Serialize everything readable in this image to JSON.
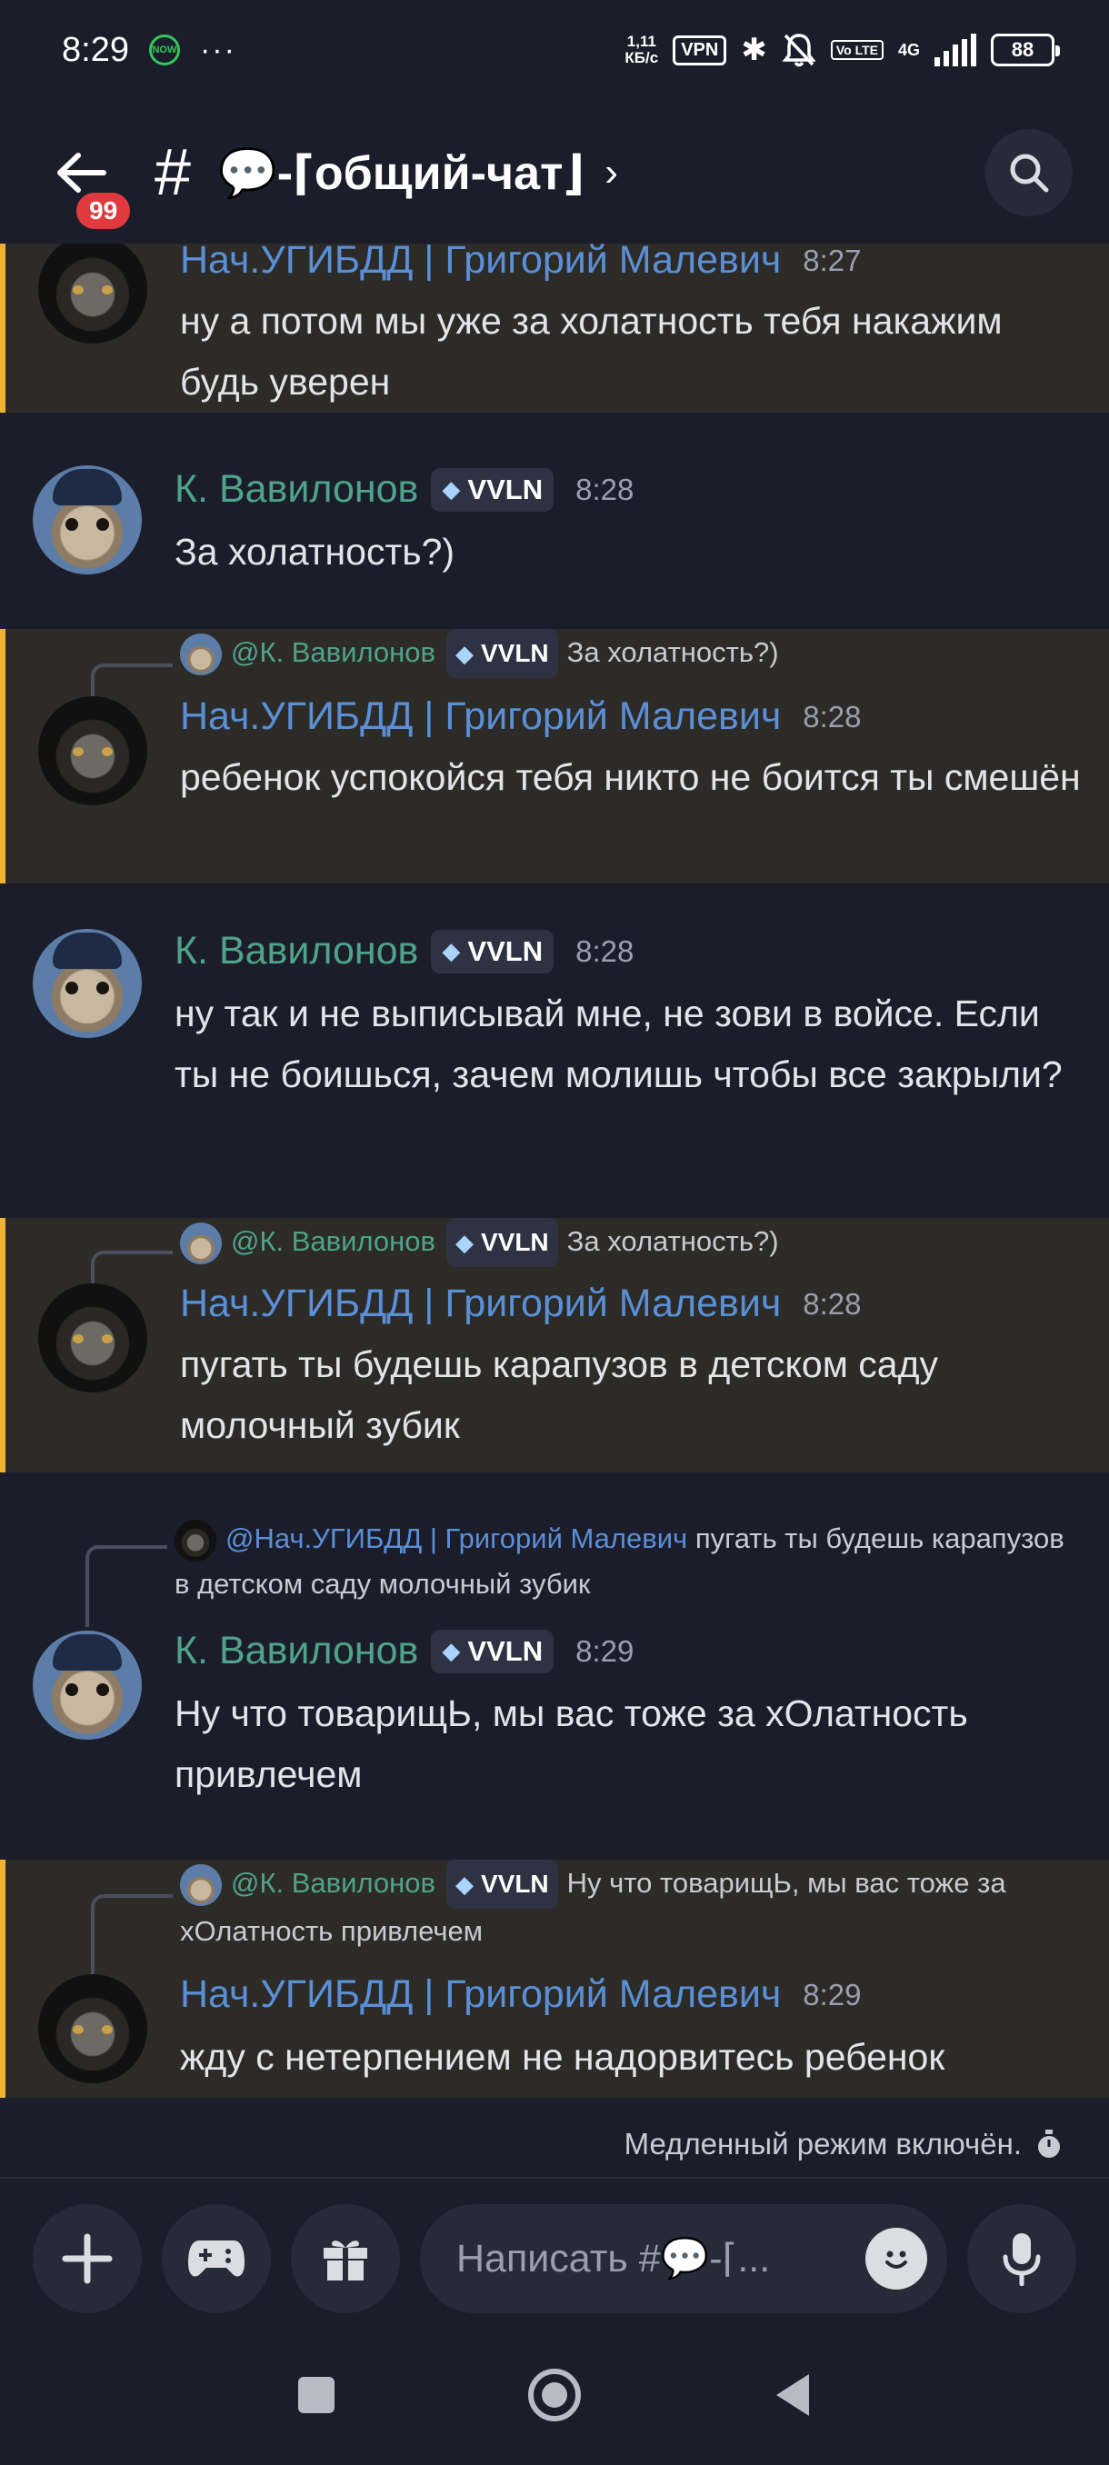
{
  "status_bar": {
    "time": "8:29",
    "now_badge": "NOW",
    "more": "···",
    "net_speed_value": "1,11",
    "net_speed_unit": "КБ/с",
    "vpn": "VPN",
    "volte": "Vo LTE",
    "network": "4G",
    "battery": "88"
  },
  "header": {
    "unread_badge": "99",
    "channel_hash": "#",
    "channel_name": "💬-⌈общий-чат⌋",
    "chevron": "›"
  },
  "messages": [
    {
      "author": "Нач.УГИБДД | Григорий Малевич",
      "time": "8:27",
      "text": "ну а потом мы уже за холатность тебя накажим будь уверен"
    },
    {
      "author": "К. Вавилонов",
      "tag": "VVLN",
      "time": "8:28",
      "text": "За холатность?)"
    },
    {
      "reply_to": "@К. Вавилонов",
      "reply_tag": "VVLN",
      "reply_text": "За холатность?)",
      "author": "Нач.УГИБДД | Григорий Малевич",
      "time": "8:28",
      "text": "ребенок успокойся тебя никто не боится ты смешён"
    },
    {
      "author": "К. Вавилонов",
      "tag": "VVLN",
      "time": "8:28",
      "text": "ну так и не выписывай мне, не зови в войсе. Если ты не боишься, зачем молишь чтобы все закрыли?"
    },
    {
      "reply_to": "@К. Вавилонов",
      "reply_tag": "VVLN",
      "reply_text": "За холатность?)",
      "author": "Нач.УГИБДД | Григорий Малевич",
      "time": "8:28",
      "text": "пугать ты будешь карапузов в детском саду молочный зубик"
    },
    {
      "reply_to": "@Нач.УГИБДД | Григорий Малевич",
      "reply_text": "пугать ты будешь карапузов в детском саду молочный зубик",
      "author": "К. Вавилонов",
      "tag": "VVLN",
      "time": "8:29",
      "text": "Ну что товарищЬ, мы вас тоже за хОлатность привлечем"
    },
    {
      "reply_to": "@К. Вавилонов",
      "reply_tag": "VVLN",
      "reply_text": "Ну что товарищЬ, мы вас тоже за хОлатность привлечем",
      "author": "Нач.УГИБДД | Григорий Малевич",
      "time": "8:29",
      "text": "жду с нетерпением не надорвитесь ребенок"
    }
  ],
  "slowmode": "Медленный режим включён.",
  "composer": {
    "placeholder": "Написать #💬-⌈..."
  },
  "colors": {
    "background": "#1b1d2a",
    "highlight_bar": "#f0b232",
    "author_blue": "#5b8fd6",
    "author_teal": "#4fa38a",
    "badge_red": "#e0393e"
  }
}
